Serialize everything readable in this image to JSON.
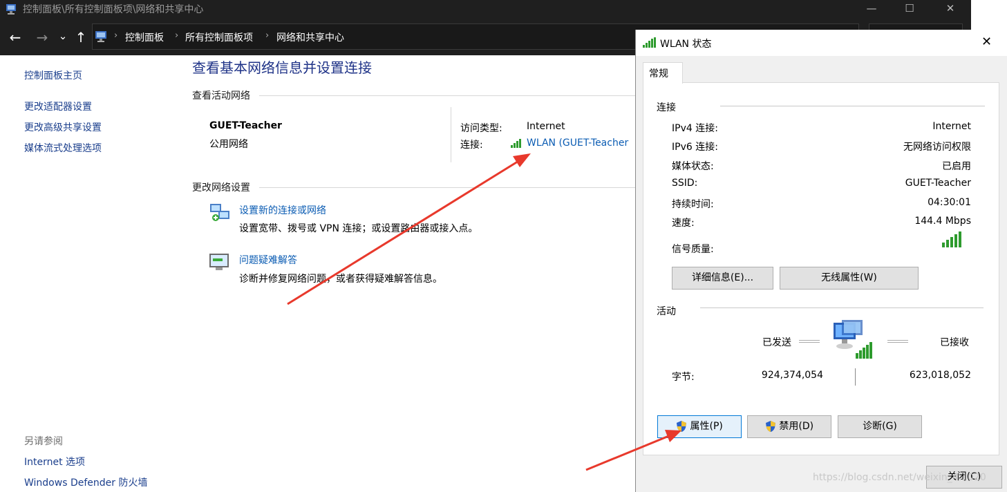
{
  "window": {
    "title": "控制面板\\所有控制面板项\\网络和共享中心",
    "minimize": "—",
    "maximize": "☐",
    "close": "✕"
  },
  "nav": {
    "back": "←",
    "forward": "→",
    "recent": "⌄",
    "up": "↑",
    "breadcrumbs": [
      "控制面板",
      "所有控制面板项",
      "网络和共享中心"
    ],
    "separator": "›"
  },
  "sidebar": {
    "home": "控制面板主页",
    "links": [
      "更改适配器设置",
      "更改高级共享设置",
      "媒体流式处理选项"
    ],
    "see_also_heading": "另请参阅",
    "see_also": [
      "Internet 选项",
      "Windows Defender 防火墙"
    ]
  },
  "main": {
    "title": "查看基本网络信息并设置连接",
    "active_heading": "查看活动网络",
    "network_name": "GUET-Teacher",
    "network_type": "公用网络",
    "access_type_label": "访问类型:",
    "access_type_value": "Internet",
    "connection_label": "连接:",
    "connection_value": "WLAN (GUET-Teacher",
    "change_heading": "更改网络设置",
    "tasks": [
      {
        "title": "设置新的连接或网络",
        "desc": "设置宽带、拨号或 VPN 连接；或设置路由器或接入点。"
      },
      {
        "title": "问题疑难解答",
        "desc": "诊断并修复网络问题，或者获得疑难解答信息。"
      }
    ]
  },
  "dialog": {
    "title": "WLAN 状态",
    "close": "✕",
    "tab": "常规",
    "connection_heading": "连接",
    "rows": [
      {
        "label": "IPv4 连接:",
        "value": "Internet"
      },
      {
        "label": "IPv6 连接:",
        "value": "无网络访问权限"
      },
      {
        "label": "媒体状态:",
        "value": "已启用"
      },
      {
        "label": "SSID:",
        "value": "GUET-Teacher"
      },
      {
        "label": "持续时间:",
        "value": "04:30:01"
      },
      {
        "label": "速度:",
        "value": "144.4 Mbps"
      }
    ],
    "signal_label": "信号质量:",
    "details_button": "详细信息(E)...",
    "wireless_button": "无线属性(W)",
    "activity_heading": "活动",
    "sent_label": "已发送",
    "received_label": "已接收",
    "bytes_label": "字节:",
    "bytes_sent": "924,374,054",
    "bytes_received": "623,018,052",
    "properties_button": "属性(P)",
    "disable_button": "禁用(D)",
    "diagnose_button": "诊断(G)",
    "close_button": "关闭(C)"
  },
  "watermark": "https://blog.csdn.net/weixin_4...020",
  "colors": {
    "title_bar": "#1f1f1f",
    "link": "#0b5cb3",
    "heading": "#1e3287",
    "signal": "#2e9b2e",
    "arrow": "#e8392c",
    "focus": "#0078d7"
  }
}
